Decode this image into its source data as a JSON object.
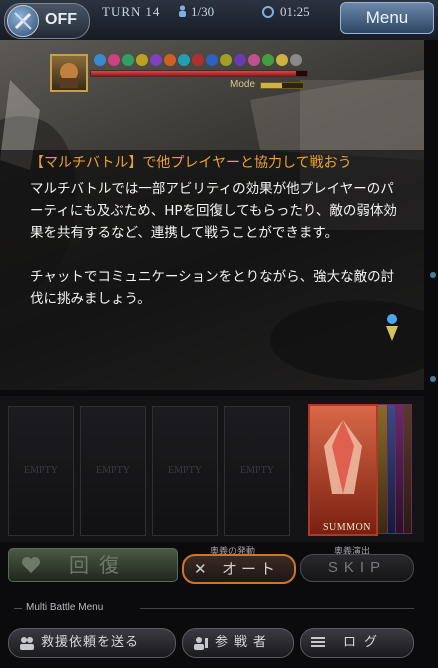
{
  "topbar": {
    "auto_label": "OFF",
    "turn_label": "TURN",
    "turn_value": "14",
    "players": "1/30",
    "timer": "01:25",
    "menu_label": "Menu"
  },
  "battle": {
    "mode_label": "Mode",
    "boss_hp_fraction": 0.95,
    "mode_fraction": 0.5
  },
  "tip": {
    "title": "【マルチバトル】で他プレイヤーと協力して戦おう",
    "body": "マルチバトルでは一部アビリティの効果が他プレイヤーのパーティにも及ぶため、HPを回復してもらったり、敵の弱体効果を共有するなど、連携して戦うことができます。\n\nチャットでコミュニケーションをとりながら、強大な敵の討伐に挑みましょう。"
  },
  "party": {
    "slots": [
      "EMPTY",
      "EMPTY",
      "EMPTY",
      "EMPTY"
    ],
    "summon_label": "SUMMON"
  },
  "actions": {
    "heal_label": "回復",
    "auto_caption": "奥義の発動",
    "auto_label": "オート",
    "skip_caption": "奥義演出",
    "skip_label": "SKIP"
  },
  "multi_menu": {
    "title": "Multi Battle Menu",
    "rescue_label": "救援依頼を送る",
    "viewers_label": "参戦者",
    "log_label": "ログ"
  },
  "colors": {
    "tip_title": "#f0a030",
    "auto_border": "#c8782c",
    "hp_bar": "#e04848"
  }
}
